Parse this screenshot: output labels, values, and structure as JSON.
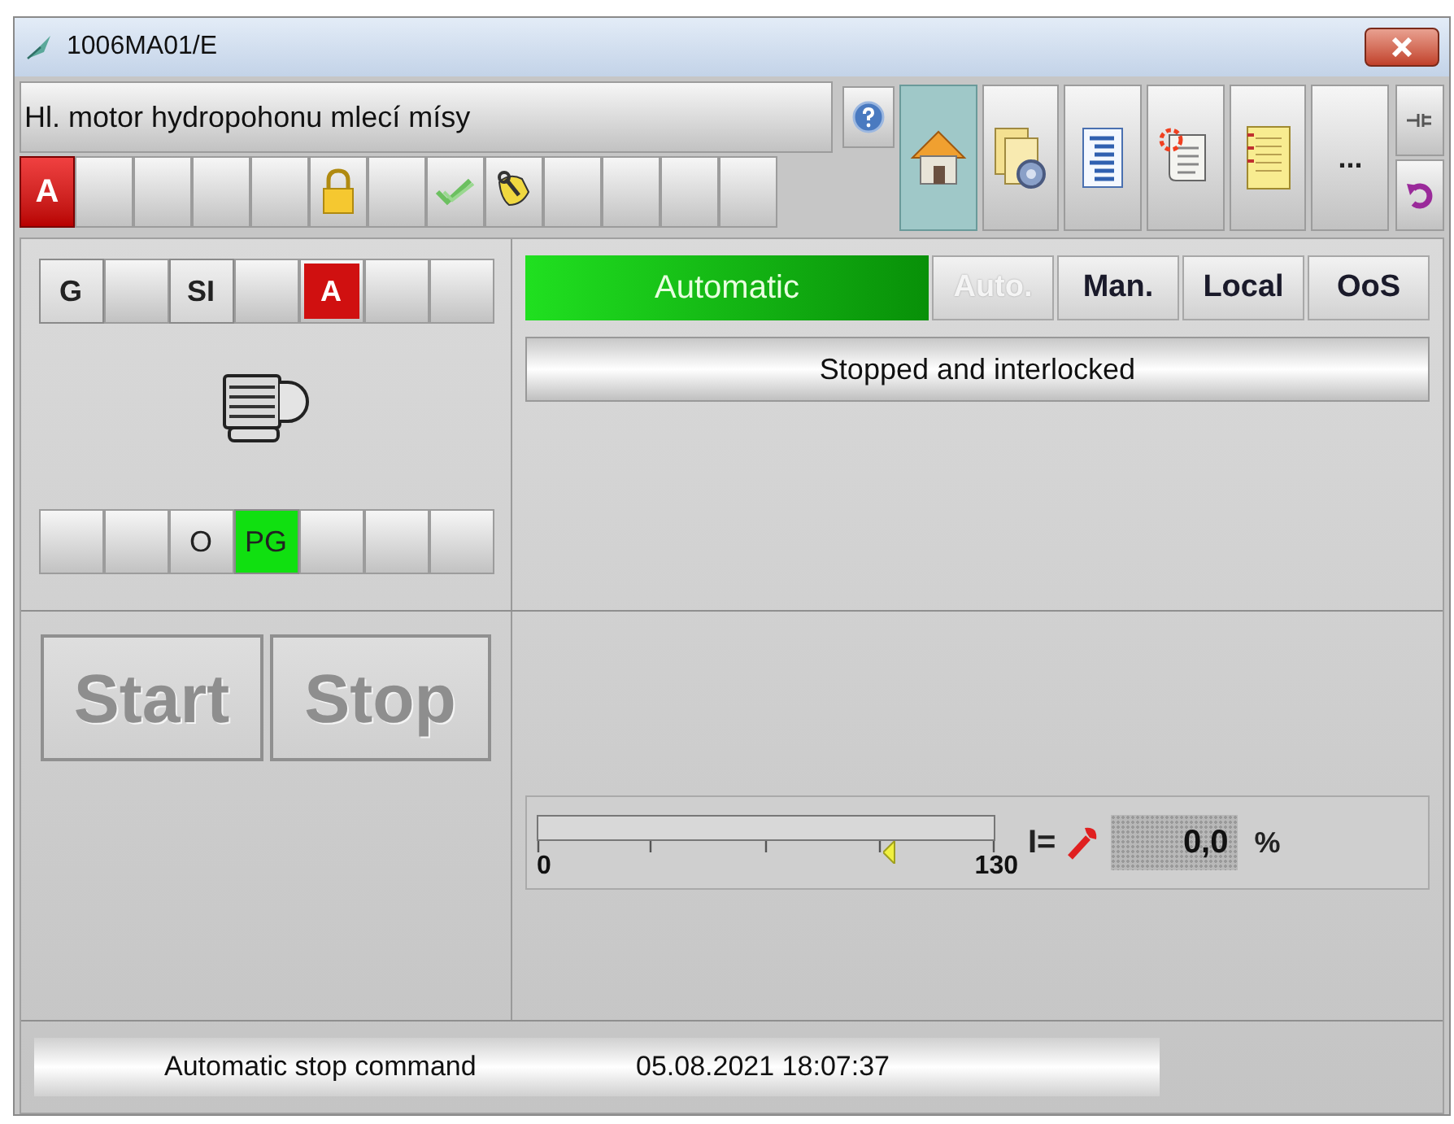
{
  "window": {
    "title": "1006MA01/E"
  },
  "header": {
    "description": "Hl. motor hydropohonu mlecí mísy"
  },
  "status_icons": [
    {
      "kind": "alarm",
      "text": "A"
    },
    {
      "kind": "empty"
    },
    {
      "kind": "empty"
    },
    {
      "kind": "empty"
    },
    {
      "kind": "empty"
    },
    {
      "kind": "lock"
    },
    {
      "kind": "empty"
    },
    {
      "kind": "check"
    },
    {
      "kind": "maintenance"
    },
    {
      "kind": "empty"
    },
    {
      "kind": "empty"
    },
    {
      "kind": "empty"
    },
    {
      "kind": "empty"
    }
  ],
  "view_buttons": [
    {
      "kind": "home",
      "selected": true
    },
    {
      "kind": "parameters",
      "selected": false
    },
    {
      "kind": "list",
      "selected": false
    },
    {
      "kind": "messages",
      "selected": false
    },
    {
      "kind": "notes",
      "selected": false
    },
    {
      "kind": "more",
      "text": "...",
      "selected": false
    }
  ],
  "side_buttons": [
    {
      "kind": "pin"
    },
    {
      "kind": "return"
    }
  ],
  "top_indicators": [
    {
      "kind": "text",
      "text": "G"
    },
    {
      "kind": "empty"
    },
    {
      "kind": "text",
      "text": "SI"
    },
    {
      "kind": "empty"
    },
    {
      "kind": "alarm",
      "text": "A"
    },
    {
      "kind": "empty"
    },
    {
      "kind": "empty"
    }
  ],
  "bottom_indicators": [
    {
      "kind": "empty"
    },
    {
      "kind": "empty"
    },
    {
      "kind": "plain",
      "text": "O"
    },
    {
      "kind": "active",
      "text": "PG"
    },
    {
      "kind": "empty"
    },
    {
      "kind": "empty"
    },
    {
      "kind": "empty"
    }
  ],
  "mode_display": "Automatic",
  "mode_buttons": [
    {
      "label": "Auto.",
      "disabled": true
    },
    {
      "label": "Man.",
      "disabled": false
    },
    {
      "label": "Local",
      "disabled": false
    },
    {
      "label": "OoS",
      "disabled": false
    }
  ],
  "state_text": "Stopped and interlocked",
  "commands": [
    {
      "label": "Start",
      "disabled": true
    },
    {
      "label": "Stop",
      "disabled": true
    }
  ],
  "bar": {
    "min": "0",
    "max": "130",
    "marker": {
      "level": 0.77
    }
  },
  "readout": {
    "prefix": "I=",
    "value": "0,0",
    "unit": "%"
  },
  "status_bar": {
    "message": "Automatic stop command",
    "time": "05.08.2021 18:07:37"
  }
}
